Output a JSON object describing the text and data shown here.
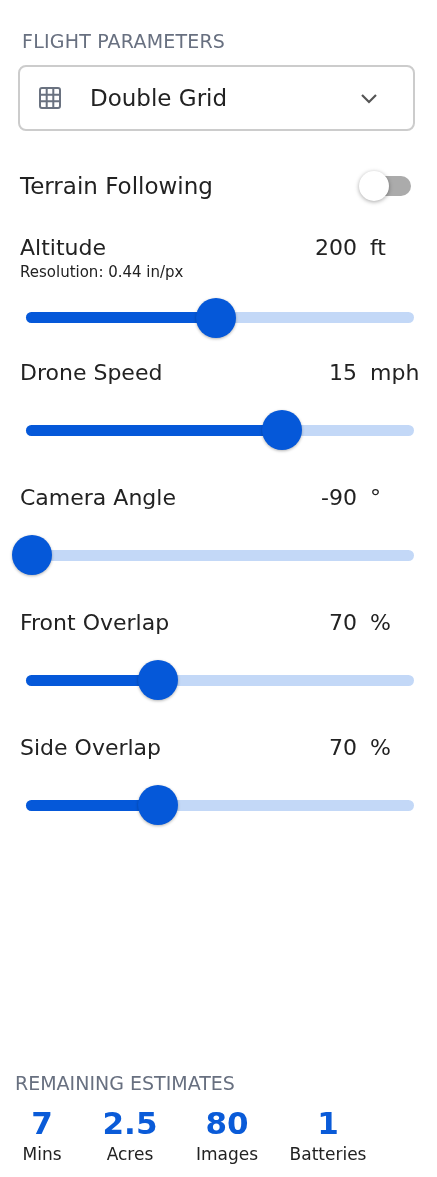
{
  "flight_parameters": {
    "title": "FLIGHT PARAMETERS",
    "pattern_select": {
      "value": "Double Grid"
    },
    "terrain_following": {
      "label": "Terrain Following",
      "on": false
    },
    "sliders": [
      {
        "label": "Altitude",
        "value": "200",
        "unit": "ft",
        "note": "Resolution: 0.44 in/px",
        "level": 0.49
      },
      {
        "label": "Drone Speed",
        "value": "15",
        "unit": "mph",
        "level": 0.66
      },
      {
        "label": "Camera Angle",
        "value": "-90",
        "unit": "°",
        "level": 0
      },
      {
        "label": "Front Overlap",
        "value": "70",
        "unit": "%",
        "level": 0.34
      },
      {
        "label": "Side Overlap",
        "value": "70",
        "unit": "%",
        "level": 0.34
      }
    ]
  },
  "remaining_estimates": {
    "title": "REMAINING ESTIMATES",
    "items": [
      {
        "value": "7",
        "label": "Mins"
      },
      {
        "value": "2.5",
        "label": "Acres"
      },
      {
        "value": "80",
        "label": "Images"
      },
      {
        "value": "1",
        "label": "Batteries"
      }
    ]
  }
}
